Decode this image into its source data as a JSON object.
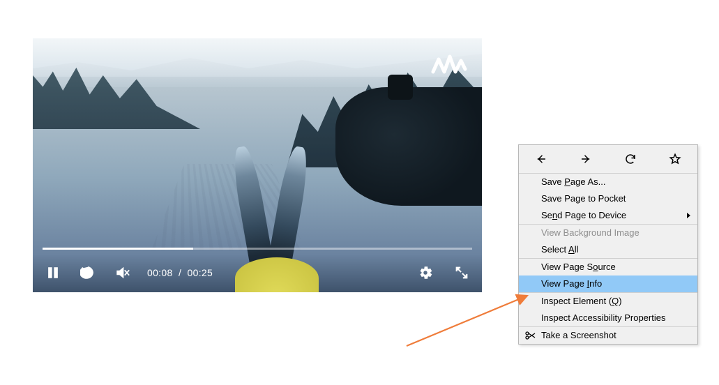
{
  "video": {
    "current_time": "00:08",
    "duration": "00:25",
    "progress_percent": 35,
    "watermark": "W"
  },
  "controls": {
    "pause": "pause-icon",
    "skip10": "skip-back-10-icon",
    "mute": "volume-muted-icon",
    "settings": "gear-icon",
    "fullscreen": "expand-icon"
  },
  "context_menu": {
    "nav": {
      "back": "back-icon",
      "forward": "forward-icon",
      "reload": "reload-icon",
      "bookmark": "star-icon"
    },
    "items": [
      {
        "label": "Save Page As...",
        "accelP": 5,
        "disabled": false
      },
      {
        "label": "Save Page to Pocket",
        "accelP": -1,
        "disabled": false
      },
      {
        "label": "Send Page to Device",
        "accelP": 2,
        "disabled": false,
        "submenu": true
      },
      {
        "sep": true
      },
      {
        "label": "View Background Image",
        "accelP": -1,
        "disabled": true
      },
      {
        "label": "Select All",
        "accelP": 7,
        "disabled": false
      },
      {
        "sep": true
      },
      {
        "label": "View Page Source",
        "accelP": 11,
        "disabled": false
      },
      {
        "label": "View Page Info",
        "accelP": 10,
        "disabled": false,
        "highlight": true
      },
      {
        "sep": true
      },
      {
        "label": "Inspect Element (Q)",
        "accelP": 17,
        "disabled": false
      },
      {
        "label": "Inspect Accessibility Properties",
        "accelP": -1,
        "disabled": false
      },
      {
        "sep": true
      },
      {
        "label": "Take a Screenshot",
        "accelP": -1,
        "disabled": false,
        "icon": "scissors-icon"
      }
    ]
  }
}
